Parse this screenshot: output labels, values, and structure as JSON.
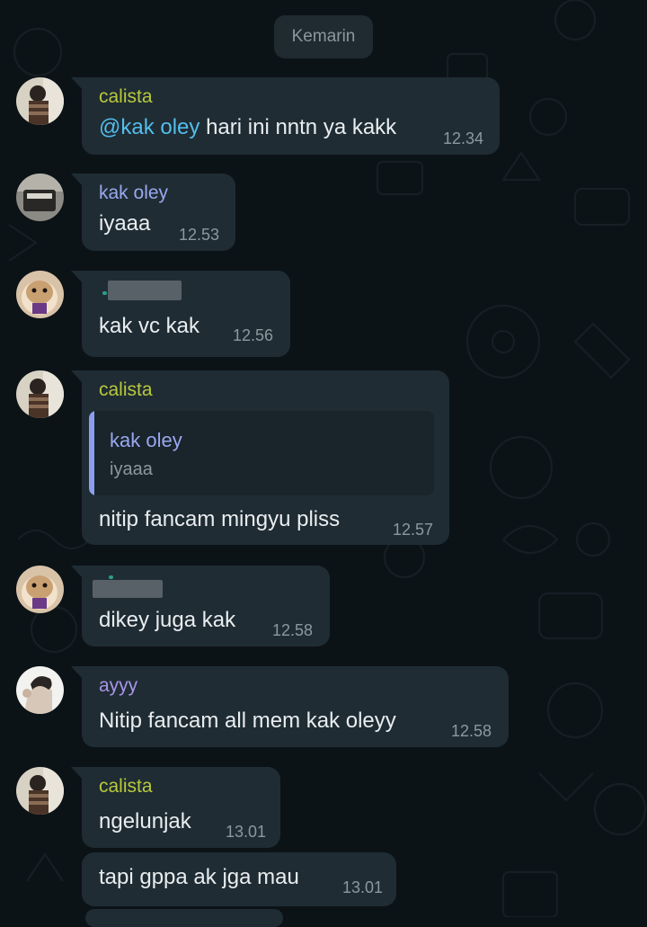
{
  "date_chip": "Kemarin",
  "colors": {
    "background": "#0c1317",
    "bubble": "#1f2c34",
    "text": "#e9edef",
    "timestamp": "#8d989e",
    "mention": "#53bdeb",
    "name_calista": "#b9c93a",
    "name_kak_oley": "#9aa8ee",
    "name_ayyy": "#a894e6"
  },
  "messages": [
    {
      "sender": "calista",
      "mention": "@kak oley",
      "text": " hari ini nntn ya kakk",
      "time": "12.34"
    },
    {
      "sender": "kak oley",
      "text": "iyaaa",
      "time": "12.53"
    },
    {
      "sender": "",
      "sender_redacted": true,
      "text": "kak vc kak",
      "time": "12.56"
    },
    {
      "sender": "calista",
      "quote": {
        "sender": "kak oley",
        "text": "iyaaa"
      },
      "text": "nitip fancam mingyu pliss",
      "time": "12.57"
    },
    {
      "sender": "",
      "sender_redacted": true,
      "text": "dikey juga kak",
      "time": "12.58"
    },
    {
      "sender": "ayyy",
      "text": "Nitip fancam all mem kak oleyy",
      "time": "12.58"
    },
    {
      "sender": "calista",
      "text": "ngelunjak",
      "time": "13.01"
    },
    {
      "sender": "",
      "text": "tapi gppa ak jga mau",
      "time": "13.01"
    }
  ]
}
